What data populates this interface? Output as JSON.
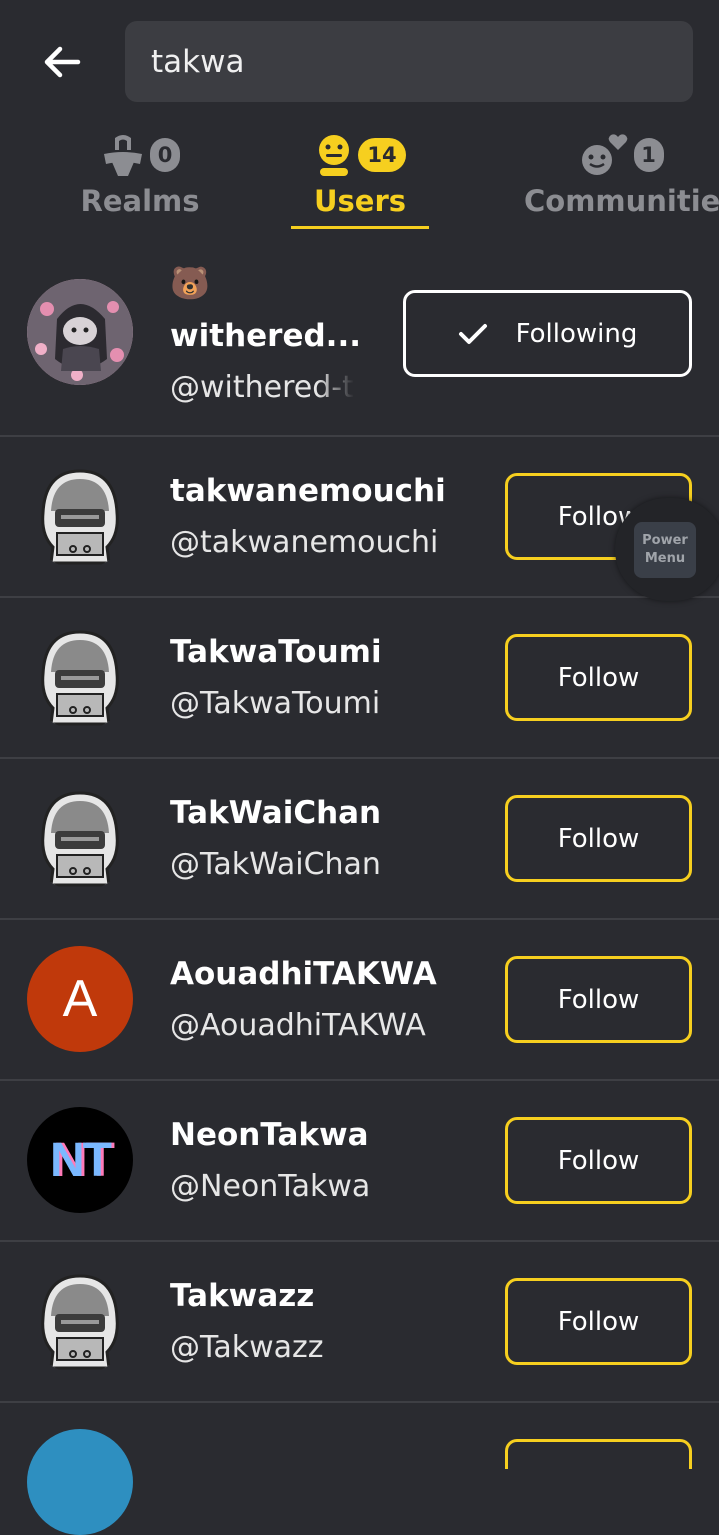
{
  "search": {
    "value": "takwa"
  },
  "tabs": [
    {
      "label": "Realms",
      "count": "0"
    },
    {
      "label": "Users",
      "count": "14"
    },
    {
      "label": "Communities",
      "count": "1"
    }
  ],
  "users": [
    {
      "emoji": "🐻",
      "name": "withered...",
      "handle": "@withered-t",
      "button": "Following",
      "avatar": "image"
    },
    {
      "name": "takwanemouchi",
      "handle": "@takwanemouchi",
      "button": "Follow",
      "avatar": "default"
    },
    {
      "name": "TakwaToumi",
      "handle": "@TakwaToumi",
      "button": "Follow",
      "avatar": "default"
    },
    {
      "name": "TakWaiChan",
      "handle": "@TakWaiChan",
      "button": "Follow",
      "avatar": "default"
    },
    {
      "name": "AouadhiTAKWA",
      "handle": "@AouadhiTAKWA",
      "button": "Follow",
      "avatar": "letter",
      "letter": "A"
    },
    {
      "name": "NeonTakwa",
      "handle": "@NeonTakwa",
      "button": "Follow",
      "avatar": "logo",
      "logo_text": "NT"
    },
    {
      "name": "Takwazz",
      "handle": "@Takwazz",
      "button": "Follow",
      "avatar": "default"
    }
  ],
  "overlay": {
    "label_line1": "Power",
    "label_line2": "Menu"
  },
  "colors": {
    "background": "#2a2b30",
    "accent": "#f6cf1f",
    "divider": "#3e3f44",
    "letter_avatar": "#c0390b"
  }
}
